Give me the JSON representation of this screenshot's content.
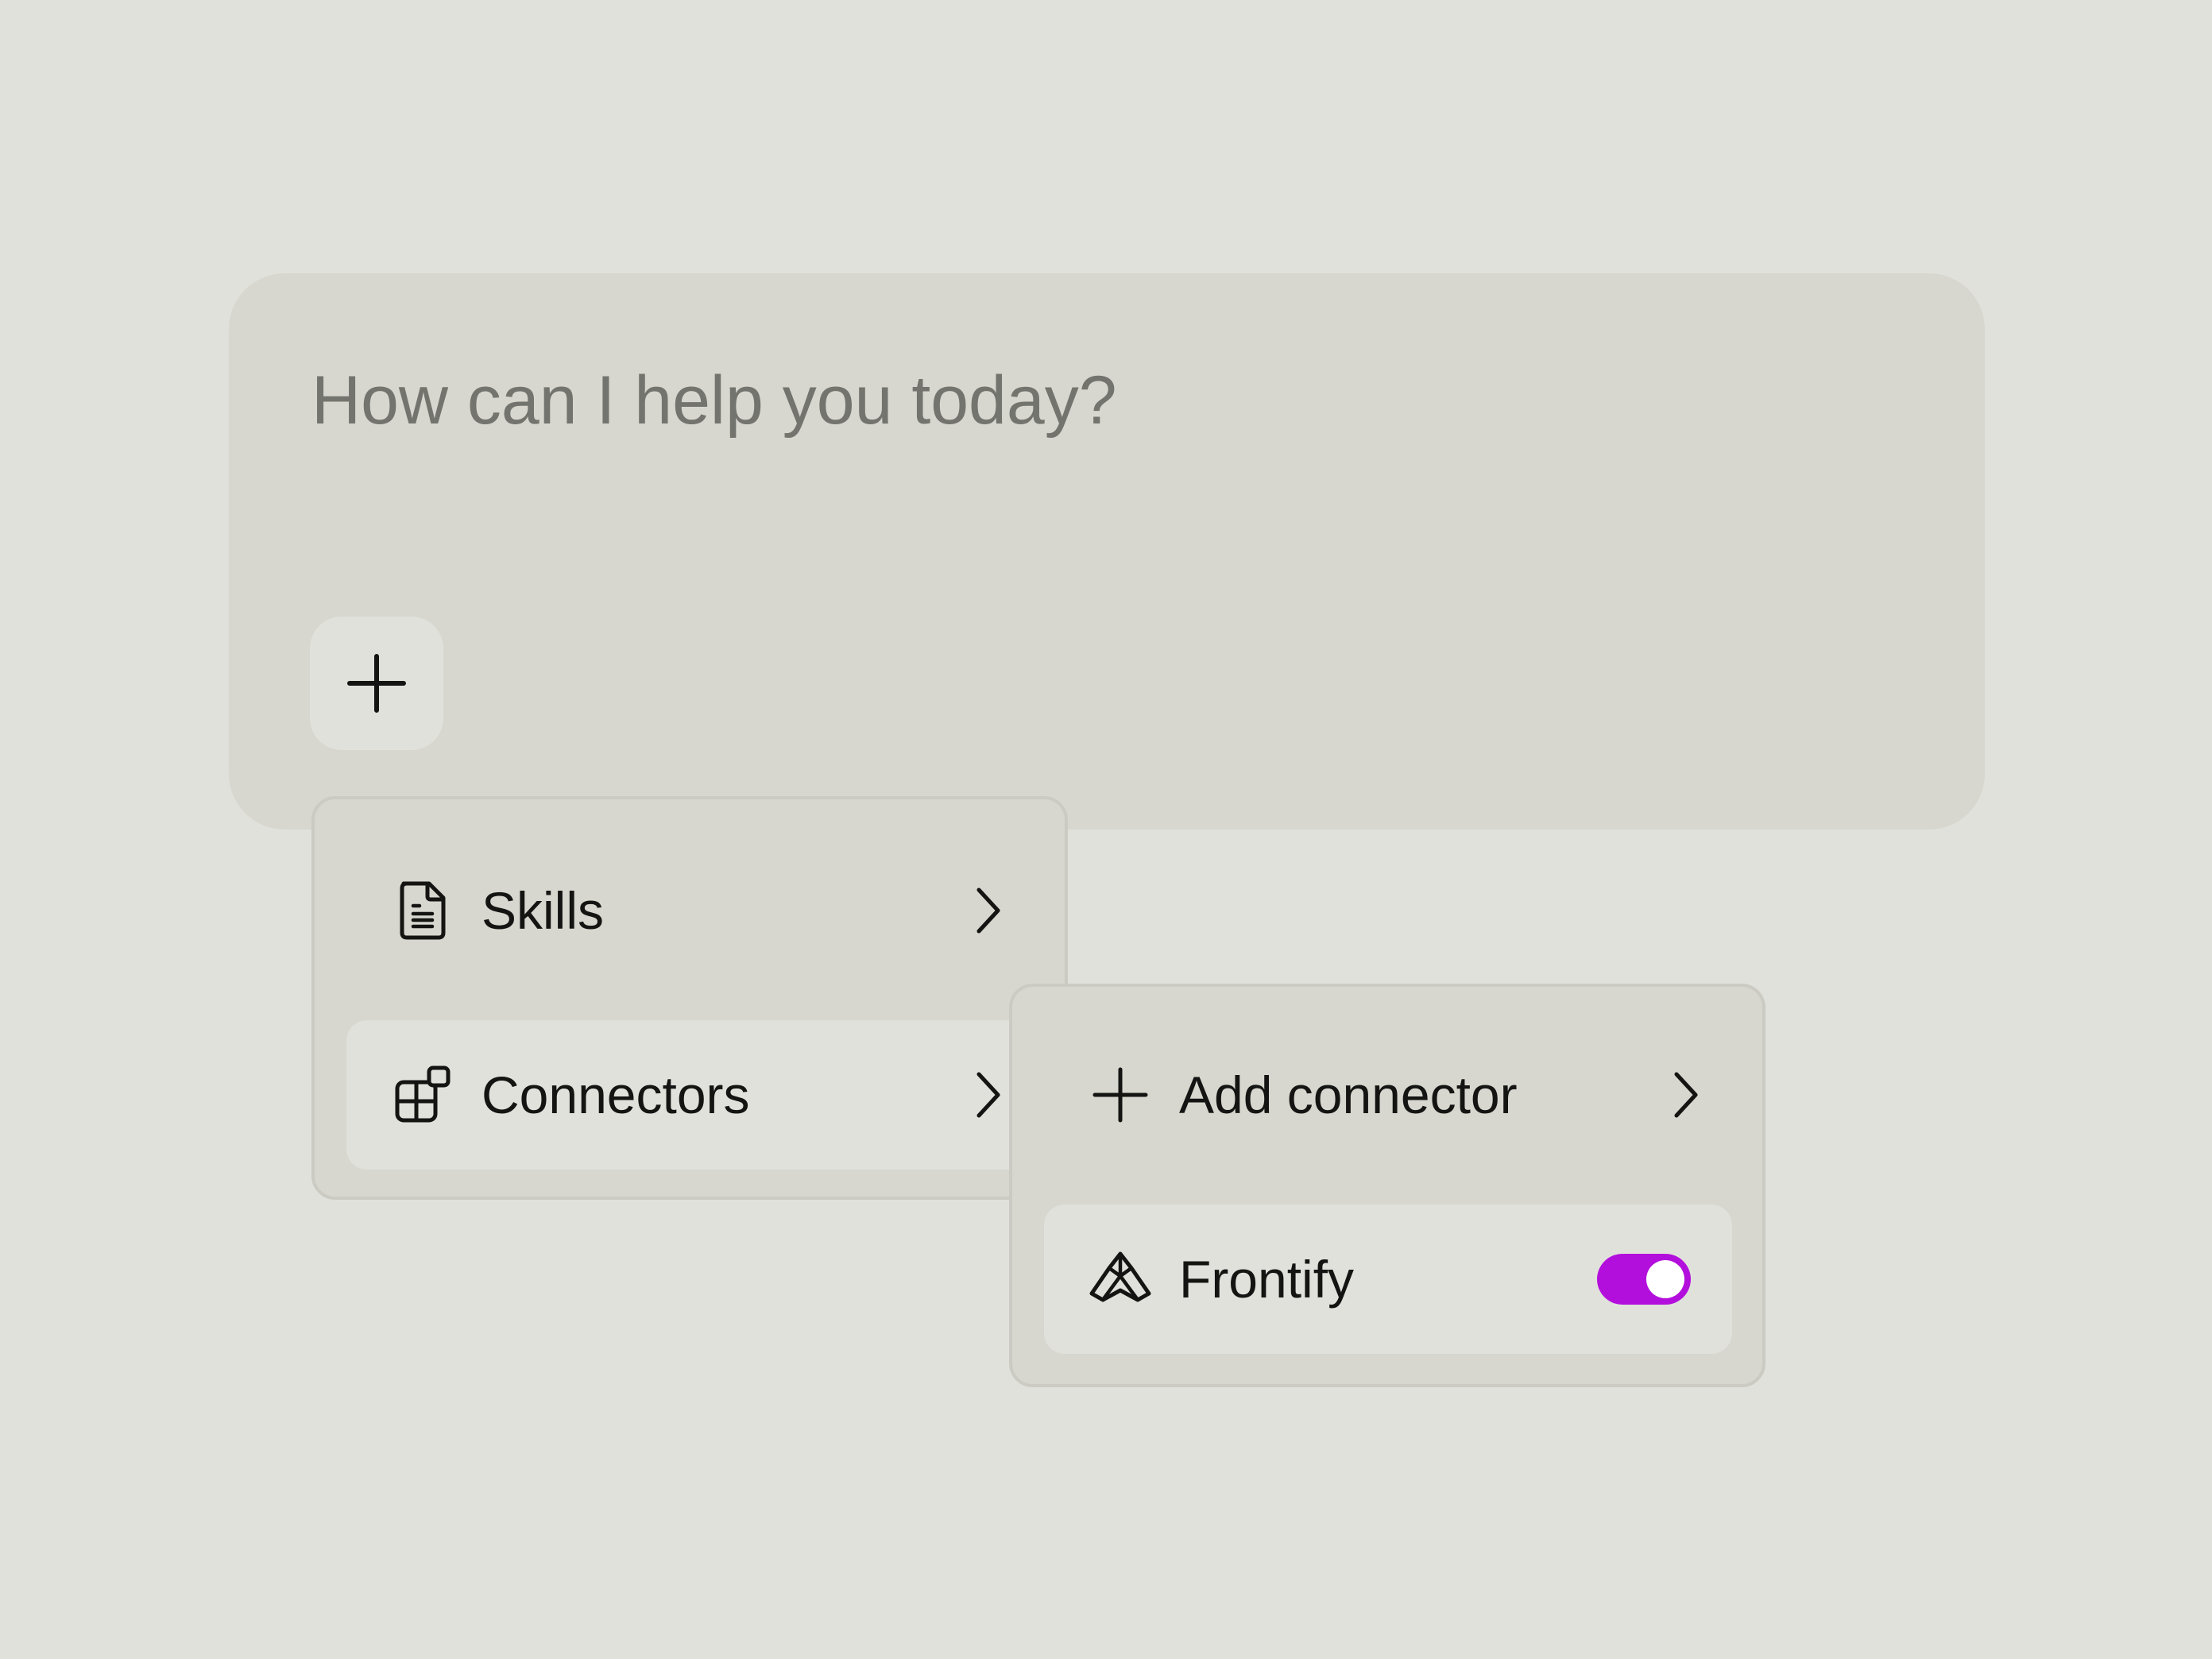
{
  "composer": {
    "placeholder": "How can I help you today?",
    "add_button_icon": "plus-icon"
  },
  "menu": {
    "items": [
      {
        "label": "Skills",
        "icon": "document-icon",
        "has_submenu": true,
        "active": false
      },
      {
        "label": "Connectors",
        "icon": "connectors-icon",
        "has_submenu": true,
        "active": true
      }
    ]
  },
  "submenu": {
    "add_connector": {
      "label": "Add connector",
      "icon": "plus-icon"
    },
    "connectors": [
      {
        "label": "Frontify",
        "icon": "frontify-logo-icon",
        "enabled": true
      }
    ]
  },
  "colors": {
    "background": "#e1e1dc",
    "surface": "#d7d7cf",
    "placeholder_text": "#74746f",
    "toggle_on": "#b30fdc"
  }
}
